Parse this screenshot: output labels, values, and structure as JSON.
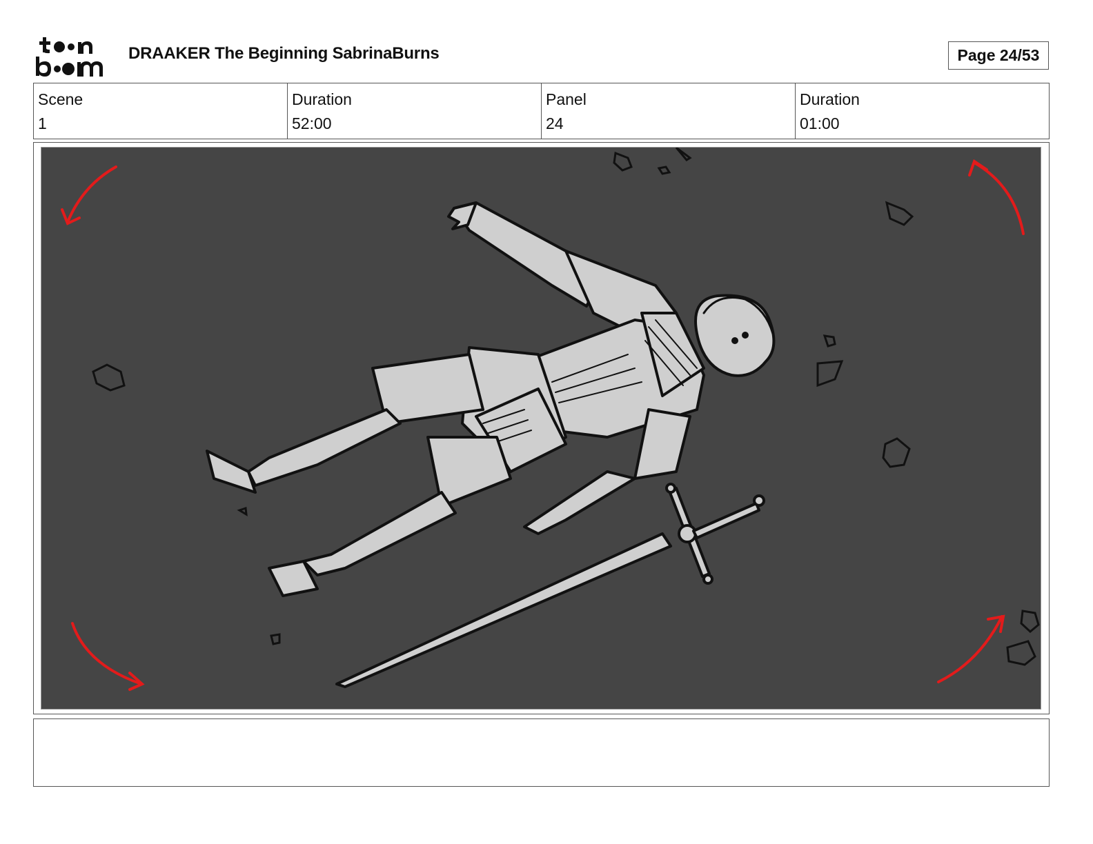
{
  "header": {
    "logo_text": "toonboom",
    "title": "DRAAKER The Beginning SabrinaBurns",
    "page_label": "Page 24/53"
  },
  "info": {
    "scene_label": "Scene",
    "scene_value": "1",
    "scene_duration_label": "Duration",
    "scene_duration_value": "52:00",
    "panel_label": "Panel",
    "panel_value": "24",
    "panel_duration_label": "Duration",
    "panel_duration_value": "01:00"
  },
  "colors": {
    "panel_background": "#454545",
    "figure_fill": "#cfcfcf",
    "camera_arrow": "#e31b1b"
  },
  "icons": [
    "toon-boom-logo",
    "rotation-arrow-icon"
  ]
}
